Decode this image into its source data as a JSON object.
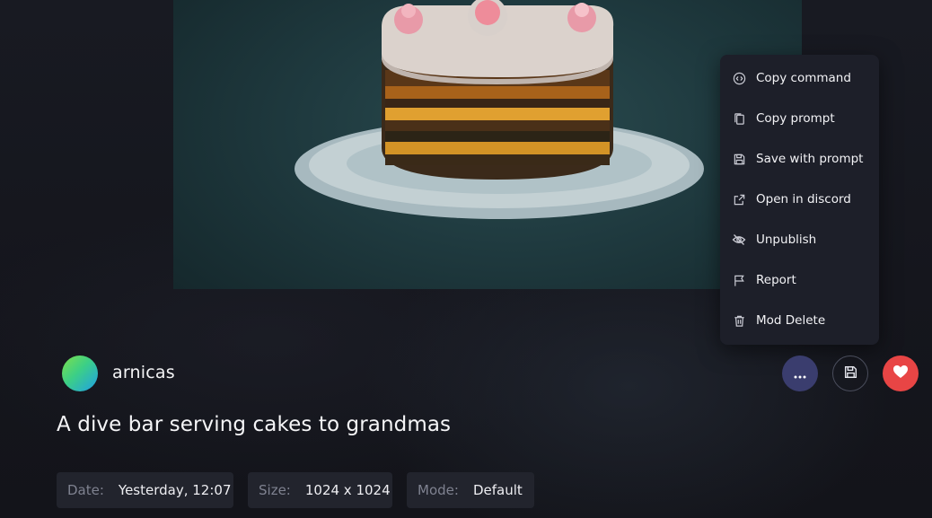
{
  "image": {
    "subject_icon": "cake-illustration"
  },
  "menu": {
    "items": [
      {
        "label": "Copy command",
        "icon": "code-icon"
      },
      {
        "label": "Copy prompt",
        "icon": "copy-icon"
      },
      {
        "label": "Save with prompt",
        "icon": "floppy-disk-icon"
      },
      {
        "label": "Open in discord",
        "icon": "external-link-icon"
      },
      {
        "label": "Unpublish",
        "icon": "eye-off-icon"
      },
      {
        "label": "Report",
        "icon": "flag-icon"
      },
      {
        "label": "Mod Delete",
        "icon": "trash-icon"
      }
    ]
  },
  "author": {
    "name": "arnicas"
  },
  "prompt": {
    "text": "A dive bar serving cakes to grandmas"
  },
  "actions": {
    "more_icon": "more-horizontal-icon",
    "save_icon": "floppy-disk-icon",
    "like_icon": "heart-icon",
    "colors": {
      "more": "#3a3d6e",
      "like": "#e84545"
    }
  },
  "info": {
    "date": {
      "label": "Date:",
      "value": "Yesterday, 12:07"
    },
    "size": {
      "label": "Size:",
      "value": "1024 x 1024"
    },
    "mode": {
      "label": "Mode:",
      "value": "Default"
    }
  }
}
